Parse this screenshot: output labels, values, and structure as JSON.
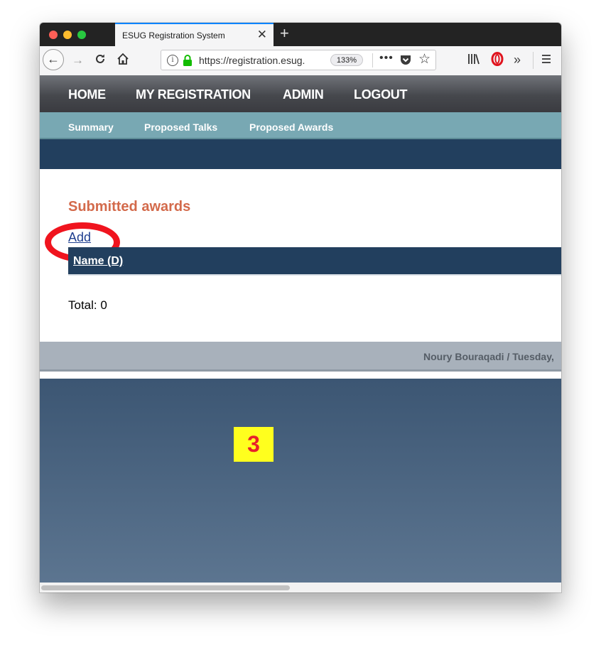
{
  "browser": {
    "tab_title": "ESUG Registration System",
    "tab_close": "✕",
    "new_tab": "+",
    "url": "https://registration.esug.org",
    "zoom": "133%",
    "more": "•••"
  },
  "nav": {
    "items": [
      "HOME",
      "MY REGISTRATION",
      "ADMIN",
      "LOGOUT"
    ]
  },
  "subnav": {
    "items": [
      "Summary",
      "Proposed Talks",
      "Proposed Awards"
    ]
  },
  "content": {
    "heading": "Submitted awards",
    "add_link": "Add",
    "table_header": "Name (D)",
    "total": "Total: 0"
  },
  "footer": {
    "text": "Noury Bouraqadi / Tuesday,"
  },
  "annotation": {
    "step": "3",
    "highlight_color": "#f0141e",
    "badge_color": "#ffff1e"
  }
}
